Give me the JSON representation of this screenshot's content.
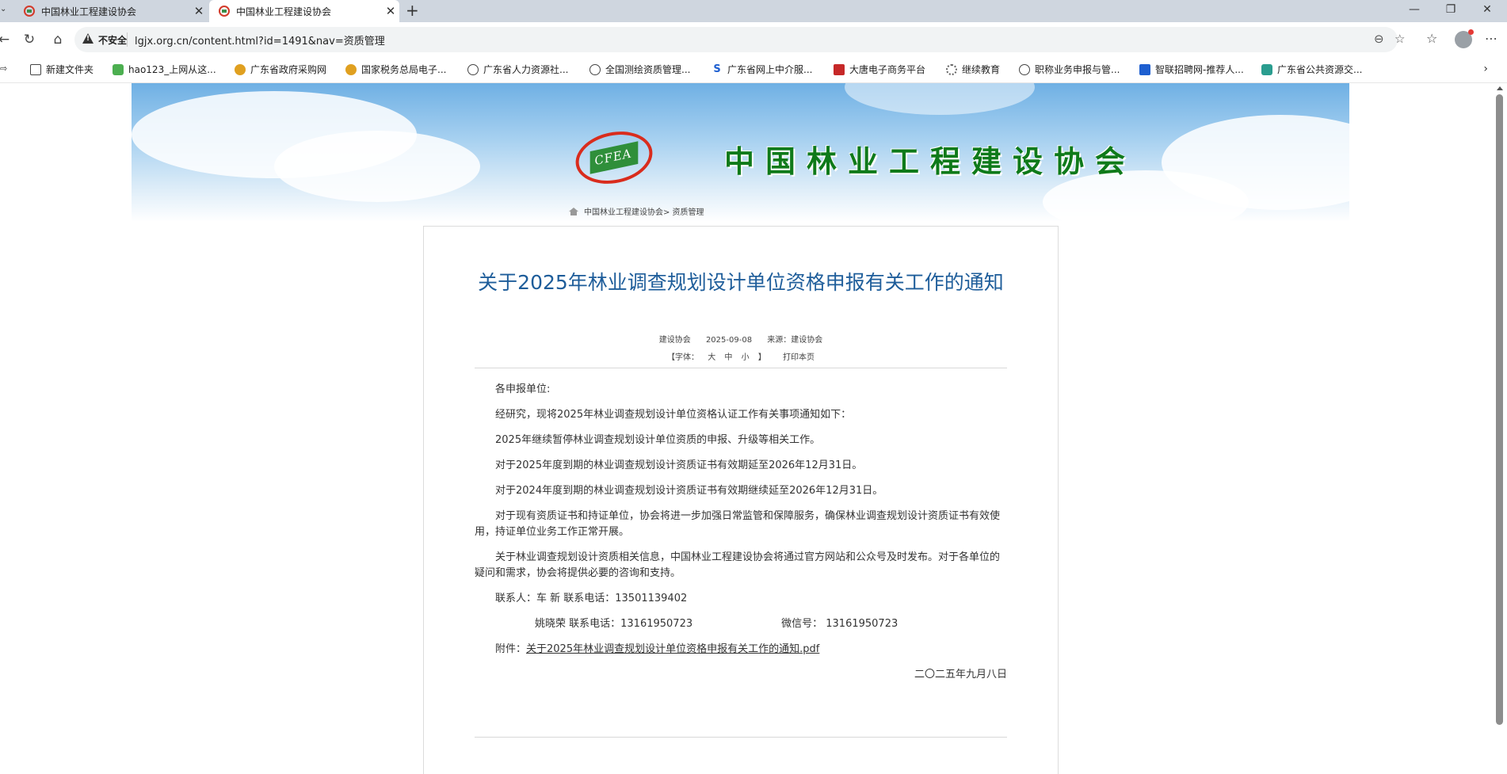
{
  "browser": {
    "tabs": [
      {
        "title": "中国林业工程建设协会",
        "active": false
      },
      {
        "title": "中国林业工程建设协会",
        "active": true
      }
    ],
    "new_tab_glyph": "+",
    "security_label": "不安全",
    "url": "lgjx.org.cn/content.html?id=1491&nav=资质管理",
    "window_controls": {
      "minimize": "—",
      "restore": "❐",
      "close": "✕"
    },
    "nav_glyphs": {
      "back": "←",
      "reload": "↻",
      "home": "⌂"
    }
  },
  "bookmarks": [
    {
      "label": "新建文件夹",
      "icon": "folder-icon"
    },
    {
      "label": "hao123_上网从这...",
      "icon": "hao123-icon"
    },
    {
      "label": "广东省政府采购网",
      "icon": "emblem-icon"
    },
    {
      "label": "国家税务总局电子...",
      "icon": "tax-icon"
    },
    {
      "label": "广东省人力资源社...",
      "icon": "globe-icon"
    },
    {
      "label": "全国测绘资质管理...",
      "icon": "globe-icon"
    },
    {
      "label": "广东省网上中介服...",
      "icon": "s-logo-icon"
    },
    {
      "label": "大唐电子商务平台",
      "icon": "datang-icon"
    },
    {
      "label": "继续教育",
      "icon": "gear-icon"
    },
    {
      "label": "职称业务申报与管...",
      "icon": "globe-icon"
    },
    {
      "label": "智联招聘网-推荐人...",
      "icon": "zhilian-icon"
    },
    {
      "label": "广东省公共资源交...",
      "icon": "resource-icon"
    }
  ],
  "site": {
    "logo_text": "CFEA",
    "name": "中国林业工程建设协会",
    "breadcrumb": "中国林业工程建设协会> 资质管理"
  },
  "article": {
    "title": "关于2025年林业调查规划设计单位资格申报有关工作的通知",
    "author": "建设协会",
    "date": "2025-09-08",
    "source": "来源：建设协会",
    "font_label": "【字体：",
    "font_large": "大",
    "font_medium": "中",
    "font_small": "小",
    "font_close": "】",
    "print_label": "打印本页",
    "paragraphs": [
      "各申报单位:",
      "经研究，现将2025年林业调查规划设计单位资格认证工作有关事项通知如下：",
      "2025年继续暂停林业调查规划设计单位资质的申报、升级等相关工作。",
      "对于2025年度到期的林业调查规划设计资质证书有效期延至2026年12月31日。",
      "对于2024年度到期的林业调查规划设计资质证书有效期继续延至2026年12月31日。",
      "对于现有资质证书和持证单位，协会将进一步加强日常监管和保障服务，确保林业调查规划设计资质证书有效使用，持证单位业务工作正常开展。",
      "关于林业调查规划设计资质相关信息，中国林业工程建设协会将通过官方网站和公众号及时发布。对于各单位的疑问和需求，协会将提供必要的咨询和支持。"
    ],
    "contact1": "联系人：车 新 联系电话：13501139402",
    "contact2": "姚晓荣 联系电话：13161950723",
    "wechat": "微信号： 13161950723",
    "attachment_label": "附件：",
    "attachment_link": "关于2025年林业调查规划设计单位资格申报有关工作的通知.pdf",
    "sign_date": "二〇二五年九月八日"
  }
}
